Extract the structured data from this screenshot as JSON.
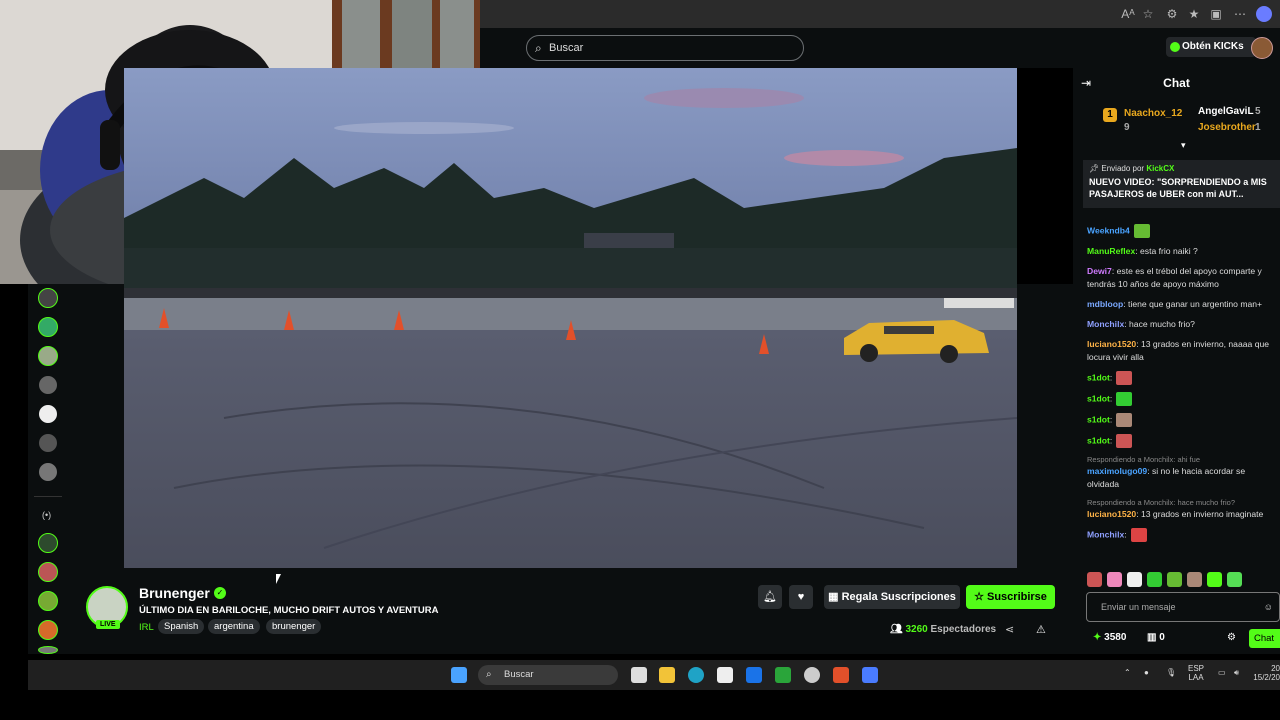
{
  "browser": {
    "search_placeholder": "Buscar"
  },
  "header": {
    "kicks_label": "Obtén KICKs"
  },
  "streamer": {
    "name": "Brunenger",
    "live_badge": "LIVE",
    "title": "ÚLTIMO DIA EN BARILOCHE, MUCHO DRIFT AUTOS Y AVENTURA",
    "category": "IRL",
    "tags": [
      "Spanish",
      "argentina",
      "brunenger"
    ],
    "viewers_count": "3260",
    "viewers_label": "Espectadores"
  },
  "actions": {
    "gift_label": "Regala Suscripciones",
    "subscribe_label": "Suscribirse"
  },
  "chat": {
    "title": "Chat",
    "leaderboard": [
      {
        "rank": "1",
        "name": "Naachox_12",
        "count": "9"
      },
      {
        "name": "AngelGaviL",
        "count": "5"
      },
      {
        "name": "Josebrother",
        "count": "1"
      }
    ],
    "pinned": {
      "sent_by": "Enviado por",
      "sender": "KickCX",
      "message": "NUEVO VIDEO: \"SORPRENDIENDO a MIS PASAJEROS de UBER con mi AUT..."
    },
    "messages": [
      {
        "user": "Weekndb4",
        "text": "",
        "color": "#4aa3ff"
      },
      {
        "user": "ManuReflex",
        "text": ": esta frio naiki ?",
        "color": "#53fc18"
      },
      {
        "user": "Dewi7",
        "text": ": este es el trébol  del apoyo  comparte y tendrás 10 años de  apoyo máximo",
        "color": "#d07bff"
      },
      {
        "user": "mdbloop",
        "text": ": tiene que ganar un argentino man+",
        "color": "#7aa8ff"
      },
      {
        "user": "Monchilx",
        "text": ": hace mucho frio?",
        "color": "#8fa0ff"
      },
      {
        "user": "luciano1520",
        "text": ": 13 grados en invierno, naaaa que locura vivir alla",
        "color": "#ffb347"
      },
      {
        "user": "s1dot",
        "text": ":",
        "color": "#53fc18"
      },
      {
        "user": "s1dot",
        "text": ":",
        "color": "#53fc18"
      },
      {
        "user": "s1dot",
        "text": ":",
        "color": "#53fc18"
      },
      {
        "user": "s1dot",
        "text": ":",
        "color": "#53fc18"
      }
    ],
    "replies": [
      {
        "reply_to": "Respondiendo a Monchilx: ahi fue",
        "user": "maximolugo09",
        "text": ": si no le hacia acordar se olvidada",
        "color": "#4aa3ff"
      },
      {
        "reply_to": "Respondiendo a Monchilx: hace mucho frio?",
        "user": "luciano1520",
        "text": ": 13 grados en invierno imaginate",
        "color": "#ffb347"
      }
    ],
    "last_user": "Monchilx",
    "input_placeholder": "Enviar un mensaje",
    "kicks_balance": "3580",
    "gifts": "0",
    "send_label": "Chat"
  },
  "taskbar": {
    "search_label": "Buscar",
    "lang_top": "ESP",
    "lang_bottom": "LAA",
    "time": "20",
    "date": "15/2/20"
  },
  "colors": {
    "accent": "#53fc18",
    "background": "#0b0e0f"
  }
}
